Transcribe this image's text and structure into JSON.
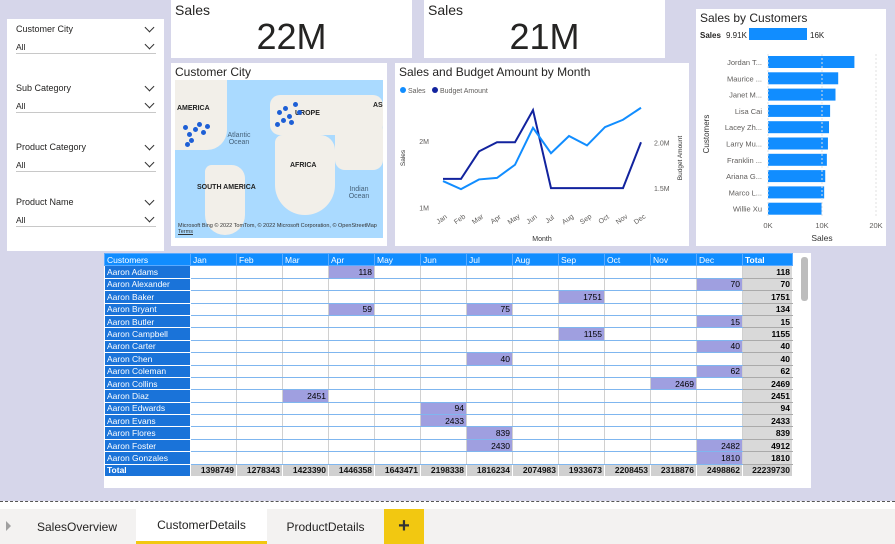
{
  "slicers": [
    {
      "label": "Customer City",
      "value": "All"
    },
    {
      "label": "Sub Category",
      "value": "All"
    },
    {
      "label": "Product Category",
      "value": "All"
    },
    {
      "label": "Product Name",
      "value": "All"
    }
  ],
  "kpis": [
    {
      "title": "Sales",
      "value": "22M"
    },
    {
      "title": "Sales",
      "value": "21M"
    }
  ],
  "map": {
    "title": "Customer City",
    "labels": {
      "america": "AMERICA",
      "europe": "UROPE",
      "asia": "AS",
      "africa": "AFRICA",
      "south_america": "SOUTH AMERICA",
      "atlantic": "Atlantic\nOcean",
      "indian": "Indian\nOcean"
    },
    "credit": "© 2022 TomTom, © 2022 Microsoft Corporation, © OpenStreetMap",
    "terms": "Terms",
    "bing": "Microsoft Bing"
  },
  "line_chart": {
    "title": "Sales and Budget Amount by Month",
    "legend": [
      {
        "name": "Sales",
        "color": "#118dff"
      },
      {
        "name": "Budget Amount",
        "color": "#12239e"
      }
    ],
    "chart_data": {
      "type": "line",
      "categories": [
        "Jan",
        "Feb",
        "Mar",
        "Apr",
        "May",
        "Jun",
        "Jul",
        "Aug",
        "Sep",
        "Oct",
        "Nov",
        "Dec"
      ],
      "series": [
        {
          "name": "Sales",
          "axis": "left",
          "values": [
            1398749,
            1278343,
            1423390,
            1446358,
            1643471,
            2198338,
            1816234,
            2074983,
            1933673,
            2208453,
            2318876,
            2498862
          ]
        },
        {
          "name": "Budget Amount",
          "axis": "right",
          "values": [
            1.6,
            1.6,
            1.9,
            2.0,
            2.0,
            2.35,
            1.5,
            1.5,
            1.5,
            1.5,
            1.5,
            2.0
          ]
        }
      ],
      "ylabel_left": "Sales",
      "ylabel_right": "Budget Amount",
      "xlabel": "Month",
      "yticks_left": [
        "2M",
        "1M"
      ],
      "yticks_right": [
        "2.0M",
        "1.5M"
      ]
    }
  },
  "bar_chart": {
    "title": "Sales by Customers",
    "legend_label": "Sales",
    "legend_min": "9.91K",
    "legend_max": "16K",
    "chart_data": {
      "type": "bar",
      "orientation": "horizontal",
      "categories": [
        "Jordan T...",
        "Maurice ...",
        "Janet M...",
        "Lisa Cai",
        "Lacey Zh...",
        "Larry Mu...",
        "Franklin ...",
        "Ariana G...",
        "Marco L...",
        "Willie Xu"
      ],
      "values": [
        16000,
        13000,
        12500,
        11500,
        11300,
        11100,
        10900,
        10600,
        10400,
        9910
      ],
      "xlabel": "Sales",
      "ylabel": "Customers",
      "xticks": [
        "0K",
        "10K",
        "20K"
      ],
      "xlim": [
        0,
        20000
      ]
    }
  },
  "matrix": {
    "columns": [
      "Customers",
      "Jan",
      "Feb",
      "Mar",
      "Apr",
      "May",
      "Jun",
      "Jul",
      "Aug",
      "Sep",
      "Oct",
      "Nov",
      "Dec",
      "Total"
    ],
    "rows": [
      {
        "name": "Aaron Adams",
        "cells": [
          "",
          "",
          "",
          "118",
          "",
          "",
          "",
          "",
          "",
          "",
          "",
          ""
        ],
        "total": "118"
      },
      {
        "name": "Aaron Alexander",
        "cells": [
          "",
          "",
          "",
          "",
          "",
          "",
          "",
          "",
          "",
          "",
          "",
          "70"
        ],
        "total": "70"
      },
      {
        "name": "Aaron Baker",
        "cells": [
          "",
          "",
          "",
          "",
          "",
          "",
          "",
          "",
          "1751",
          "",
          "",
          ""
        ],
        "total": "1751"
      },
      {
        "name": "Aaron Bryant",
        "cells": [
          "",
          "",
          "",
          "59",
          "",
          "",
          "75",
          "",
          "",
          "",
          "",
          ""
        ],
        "total": "134"
      },
      {
        "name": "Aaron Butler",
        "cells": [
          "",
          "",
          "",
          "",
          "",
          "",
          "",
          "",
          "",
          "",
          "",
          "15"
        ],
        "total": "15"
      },
      {
        "name": "Aaron Campbell",
        "cells": [
          "",
          "",
          "",
          "",
          "",
          "",
          "",
          "",
          "1155",
          "",
          "",
          ""
        ],
        "total": "1155"
      },
      {
        "name": "Aaron Carter",
        "cells": [
          "",
          "",
          "",
          "",
          "",
          "",
          "",
          "",
          "",
          "",
          "",
          "40"
        ],
        "total": "40"
      },
      {
        "name": "Aaron Chen",
        "cells": [
          "",
          "",
          "",
          "",
          "",
          "",
          "40",
          "",
          "",
          "",
          "",
          ""
        ],
        "total": "40"
      },
      {
        "name": "Aaron Coleman",
        "cells": [
          "",
          "",
          "",
          "",
          "",
          "",
          "",
          "",
          "",
          "",
          "",
          "62"
        ],
        "total": "62"
      },
      {
        "name": "Aaron Collins",
        "cells": [
          "",
          "",
          "",
          "",
          "",
          "",
          "",
          "",
          "",
          "",
          "2469",
          ""
        ],
        "total": "2469"
      },
      {
        "name": "Aaron Diaz",
        "cells": [
          "",
          "",
          "2451",
          "",
          "",
          "",
          "",
          "",
          "",
          "",
          "",
          ""
        ],
        "total": "2451"
      },
      {
        "name": "Aaron Edwards",
        "cells": [
          "",
          "",
          "",
          "",
          "",
          "94",
          "",
          "",
          "",
          "",
          "",
          ""
        ],
        "total": "94"
      },
      {
        "name": "Aaron Evans",
        "cells": [
          "",
          "",
          "",
          "",
          "",
          "2433",
          "",
          "",
          "",
          "",
          "",
          ""
        ],
        "total": "2433"
      },
      {
        "name": "Aaron Flores",
        "cells": [
          "",
          "",
          "",
          "",
          "",
          "",
          "839",
          "",
          "",
          "",
          "",
          ""
        ],
        "total": "839"
      },
      {
        "name": "Aaron Foster",
        "cells": [
          "",
          "",
          "",
          "",
          "",
          "",
          "2430",
          "",
          "",
          "",
          "",
          "2482"
        ],
        "total": "4912"
      },
      {
        "name": "Aaron Gonzales",
        "cells": [
          "",
          "",
          "",
          "",
          "",
          "",
          "",
          "",
          "",
          "",
          "",
          "1810"
        ],
        "total": "1810"
      }
    ],
    "total_row": {
      "name": "Total",
      "cells": [
        "1398749",
        "1278343",
        "1423390",
        "1446358",
        "1643471",
        "2198338",
        "1816234",
        "2074983",
        "1933673",
        "2208453",
        "2318876",
        "2498862"
      ],
      "total": "22239730"
    }
  },
  "tabs": [
    {
      "label": "SalesOverview",
      "active": false
    },
    {
      "label": "CustomerDetails",
      "active": true
    },
    {
      "label": "ProductDetails",
      "active": false
    }
  ],
  "add_tab_label": "+",
  "colors": {
    "accent": "#118dff",
    "dark_series": "#12239e",
    "tab_highlight": "#f2c811",
    "cell_highlight": "#9f9fe0"
  }
}
